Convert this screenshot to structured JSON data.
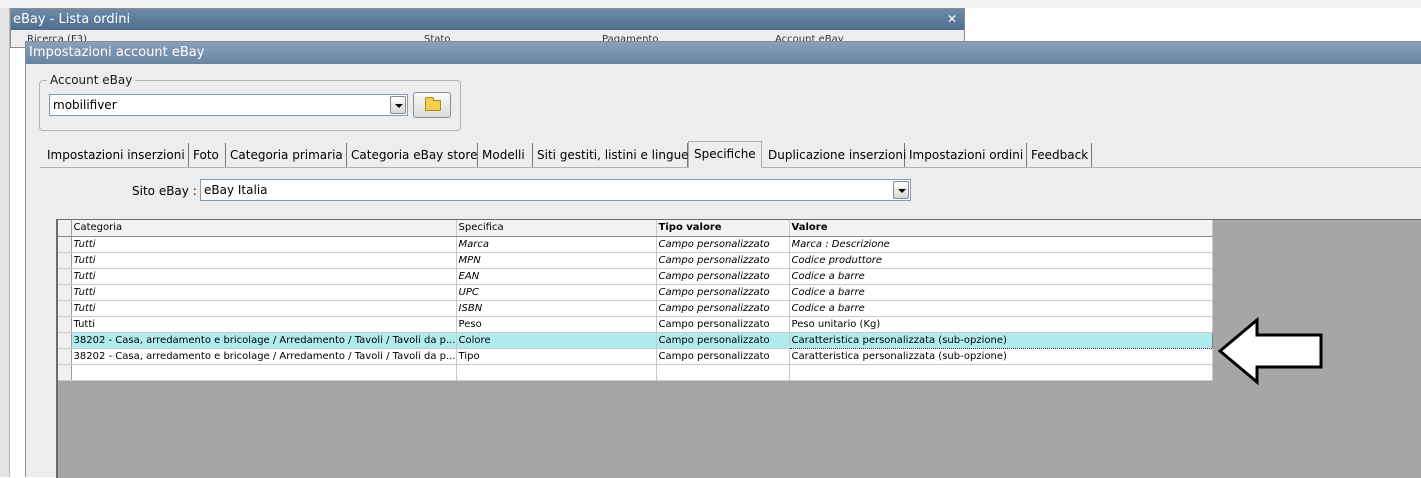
{
  "background_window": {
    "title": "eBay - Lista ordini",
    "close_glyph": "✕",
    "headers": [
      "Ricerca (F3)",
      "Stato",
      "Pagamento",
      "Account eBay"
    ]
  },
  "dialog": {
    "title": "Impostazioni account eBay",
    "account": {
      "legend": "Account eBay",
      "selected": "mobilifiver"
    },
    "tabs": [
      {
        "label": "Impostazioni inserzioni"
      },
      {
        "label": "Foto"
      },
      {
        "label": "Categoria primaria"
      },
      {
        "label": "Categoria eBay store"
      },
      {
        "label": "Modelli"
      },
      {
        "label": "Siti gestiti, listini e lingue"
      },
      {
        "label": "Specifiche",
        "active": true
      },
      {
        "label": "Duplicazione inserzioni"
      },
      {
        "label": "Impostazioni ordini"
      },
      {
        "label": "Feedback"
      }
    ],
    "site": {
      "label": "Sito eBay :",
      "selected": "eBay Italia"
    },
    "grid": {
      "columns": [
        "Categoria",
        "Specifica",
        "Tipo valore",
        "Valore"
      ],
      "rows": [
        {
          "categoria": "Tutti",
          "specifica": "Marca",
          "tipo": "Campo personalizzato",
          "valore": "Marca : Descrizione"
        },
        {
          "categoria": "Tutti",
          "specifica": "MPN",
          "tipo": "Campo personalizzato",
          "valore": "Codice produttore"
        },
        {
          "categoria": "Tutti",
          "specifica": "EAN",
          "tipo": "Campo personalizzato",
          "valore": "Codice a barre"
        },
        {
          "categoria": "Tutti",
          "specifica": "UPC",
          "tipo": "Campo personalizzato",
          "valore": "Codice a barre"
        },
        {
          "categoria": "Tutti",
          "specifica": "ISBN",
          "tipo": "Campo personalizzato",
          "valore": "Codice a barre"
        },
        {
          "categoria": "Tutti",
          "specifica": "Peso",
          "tipo": "Campo personalizzato",
          "valore": "Peso unitario (Kg)"
        },
        {
          "categoria": "38202 - Casa, arredamento e bricolage / Arredamento / Tavoli / Tavoli da p...",
          "specifica": "Colore",
          "tipo": "Campo personalizzato",
          "valore": "Caratteristica personalizzata (sub-opzione)"
        },
        {
          "categoria": "38202 - Casa, arredamento e bricolage / Arredamento / Tavoli / Tavoli da p...",
          "specifica": "Tipo",
          "tipo": "Campo personalizzato",
          "valore": "Caratteristica personalizzata (sub-opzione)"
        },
        {
          "categoria": "",
          "specifica": "",
          "tipo": "",
          "valore": ""
        }
      ]
    }
  },
  "colors": {
    "selected_row": "#b0ecee",
    "grid_background": "#a6a6a6",
    "titlebar": "#6684a2"
  },
  "icons": [
    "close-icon",
    "dropdown-arrow-icon",
    "folder-icon",
    "left-arrow-annotation-icon"
  ]
}
